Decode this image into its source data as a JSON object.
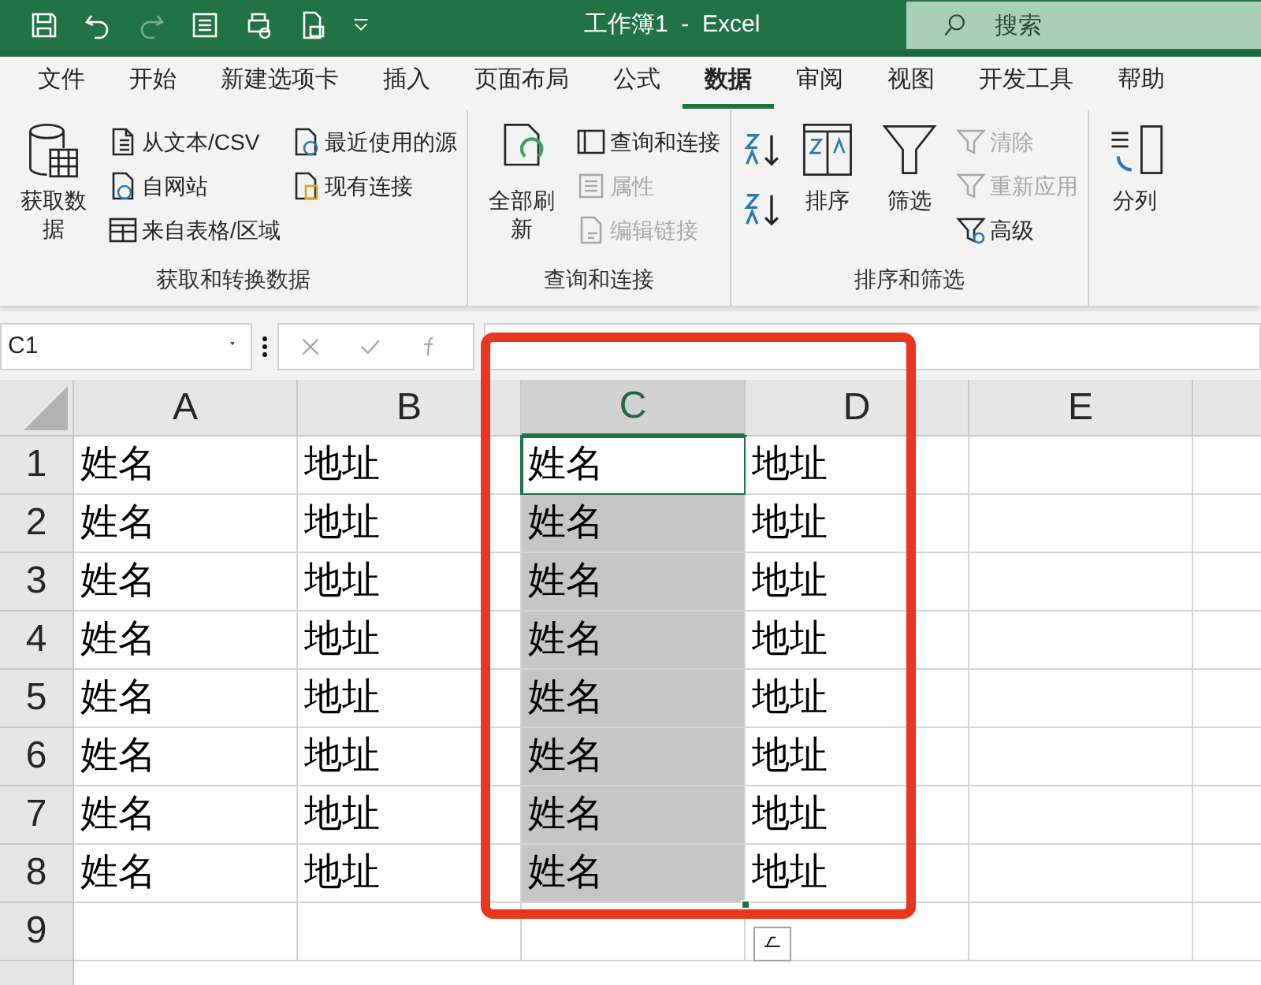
{
  "title_bar": {
    "title": "工作簿1  -  Excel",
    "search": {
      "placeholder": "搜索"
    }
  },
  "tabs": [
    {
      "label": "文件",
      "selected": false
    },
    {
      "label": "开始",
      "selected": false
    },
    {
      "label": "新建选项卡",
      "selected": false
    },
    {
      "label": "插入",
      "selected": false
    },
    {
      "label": "页面布局",
      "selected": false
    },
    {
      "label": "公式",
      "selected": false
    },
    {
      "label": "数据",
      "selected": true
    },
    {
      "label": "审阅",
      "selected": false
    },
    {
      "label": "视图",
      "selected": false
    },
    {
      "label": "开发工具",
      "selected": false
    },
    {
      "label": "帮助",
      "selected": false
    }
  ],
  "ribbon": {
    "groups": [
      {
        "label": "获取和转换数据",
        "columns": [
          [
            {
              "kind": "large",
              "label": "获取数据",
              "disabled": false
            }
          ],
          [
            {
              "kind": "small",
              "label": "从文本/CSV",
              "disabled": false
            },
            {
              "kind": "small",
              "label": "自网站",
              "disabled": false
            },
            {
              "kind": "small",
              "label": "来自表格/区域",
              "disabled": false
            }
          ],
          [
            {
              "kind": "small",
              "label": "最近使用的源",
              "disabled": false
            },
            {
              "kind": "small",
              "label": "现有连接",
              "disabled": false
            }
          ]
        ]
      },
      {
        "label": "查询和连接",
        "columns": [
          [
            {
              "kind": "large",
              "label": "全部刷新",
              "disabled": false
            }
          ],
          [
            {
              "kind": "small",
              "label": "查询和连接",
              "disabled": false
            },
            {
              "kind": "small",
              "label": "属性",
              "disabled": true
            },
            {
              "kind": "small",
              "label": "编辑链接",
              "disabled": true
            }
          ]
        ]
      },
      {
        "label": "排序和筛选",
        "columns": [
          [
            {
              "kind": "icon",
              "disabled": false
            },
            {
              "kind": "icon",
              "disabled": false
            }
          ],
          [
            {
              "kind": "large",
              "label": "排序",
              "disabled": false
            }
          ],
          [
            {
              "kind": "large",
              "label": "筛选",
              "disabled": false
            }
          ],
          [
            {
              "kind": "small",
              "label": "清除",
              "disabled": true
            },
            {
              "kind": "small",
              "label": "重新应用",
              "disabled": true
            },
            {
              "kind": "small",
              "label": "高级",
              "disabled": false
            }
          ]
        ]
      },
      {
        "columns": [
          [
            {
              "kind": "large",
              "label": "分列",
              "disabled": false
            }
          ]
        ]
      }
    ]
  },
  "formula_bar": {
    "name_box": "C1"
  },
  "sheet": {
    "columns": [
      {
        "label": "A",
        "selected": false
      },
      {
        "label": "B",
        "selected": false
      },
      {
        "label": "C",
        "selected": true
      },
      {
        "label": "D",
        "selected": false
      },
      {
        "label": "E",
        "selected": false
      }
    ],
    "rows": [
      {
        "number": "1",
        "cells": [
          {
            "text": "姓名",
            "selected": false
          },
          {
            "text": "地址",
            "selected": false
          },
          {
            "text": "姓名",
            "active": true
          },
          {
            "text": "地址",
            "selected": false
          },
          {
            "selected": false
          }
        ]
      },
      {
        "number": "2",
        "cells": [
          {
            "text": "姓名",
            "selected": false
          },
          {
            "text": "地址",
            "selected": false
          },
          {
            "text": "姓名",
            "selected": true,
            "active": false
          },
          {
            "text": "地址",
            "selected": false
          },
          {
            "selected": false
          }
        ]
      },
      {
        "number": "3",
        "cells": [
          {
            "text": "姓名",
            "selected": false
          },
          {
            "text": "地址",
            "selected": false
          },
          {
            "text": "姓名",
            "selected": true,
            "active": false
          },
          {
            "text": "地址",
            "selected": false
          },
          {
            "selected": false
          }
        ]
      },
      {
        "number": "4",
        "cells": [
          {
            "text": "姓名",
            "selected": false
          },
          {
            "text": "地址",
            "selected": false
          },
          {
            "text": "姓名",
            "selected": true,
            "active": false
          },
          {
            "text": "地址",
            "selected": false
          },
          {
            "selected": false
          }
        ]
      },
      {
        "number": "5",
        "cells": [
          {
            "text": "姓名",
            "selected": false
          },
          {
            "text": "地址",
            "selected": false
          },
          {
            "text": "姓名",
            "selected": true,
            "active": false
          },
          {
            "text": "地址",
            "selected": false
          },
          {
            "selected": false
          }
        ]
      },
      {
        "number": "6",
        "cells": [
          {
            "text": "姓名",
            "selected": false
          },
          {
            "text": "地址",
            "selected": false
          },
          {
            "text": "姓名",
            "selected": true,
            "active": false
          },
          {
            "text": "地址",
            "selected": false
          },
          {
            "selected": false
          }
        ]
      },
      {
        "number": "7",
        "cells": [
          {
            "text": "姓名",
            "selected": false
          },
          {
            "text": "地址",
            "selected": false
          },
          {
            "text": "姓名",
            "selected": true,
            "active": false
          },
          {
            "text": "地址",
            "selected": false
          },
          {
            "selected": false
          }
        ]
      },
      {
        "number": "8",
        "cells": [
          {
            "text": "姓名",
            "selected": false
          },
          {
            "text": "地址",
            "selected": false
          },
          {
            "text": "姓名",
            "selected": true,
            "active": false
          },
          {
            "text": "地址",
            "selected": false
          },
          {
            "selected": false
          }
        ]
      },
      {
        "number": "9",
        "cells": [
          {
            "selected": false
          },
          {
            "selected": false
          },
          {
            "selected": false
          },
          {
            "selected": false
          },
          {
            "selected": false
          }
        ]
      }
    ]
  }
}
